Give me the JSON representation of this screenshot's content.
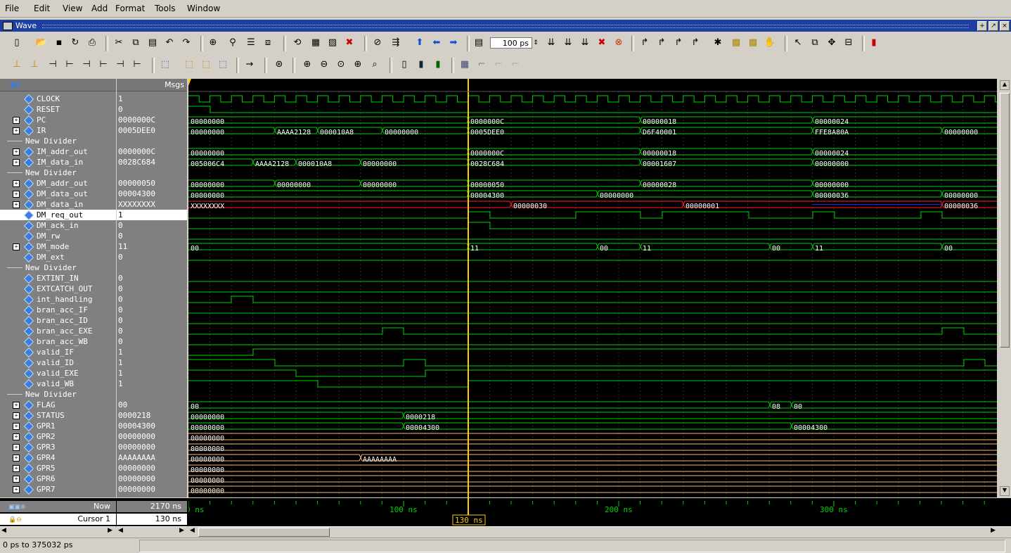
{
  "menu": [
    "File",
    "Edit",
    "View",
    "Add",
    "Format",
    "Tools",
    "Window"
  ],
  "window": {
    "title": "Wave"
  },
  "toolbar": {
    "zoom_value": "100 ps"
  },
  "headers": {
    "msgs": "Msgs"
  },
  "rows": [
    {
      "name": "CLOCK",
      "value": "1",
      "kind": "sig"
    },
    {
      "name": "RESET",
      "value": "0",
      "kind": "sig"
    },
    {
      "name": "PC",
      "value": "0000000C",
      "kind": "bus"
    },
    {
      "name": "IR",
      "value": "0005DEE0",
      "kind": "bus"
    },
    {
      "name": "New Divider",
      "value": "",
      "kind": "div"
    },
    {
      "name": "IM_addr_out",
      "value": "0000000C",
      "kind": "bus"
    },
    {
      "name": "IM_data_in",
      "value": "0028C684",
      "kind": "bus"
    },
    {
      "name": "New Divider",
      "value": "",
      "kind": "div"
    },
    {
      "name": "DM_addr_out",
      "value": "00000050",
      "kind": "bus"
    },
    {
      "name": "DM_data_out",
      "value": "00004300",
      "kind": "bus"
    },
    {
      "name": "DM_data_in",
      "value": "XXXXXXXX",
      "kind": "bus"
    },
    {
      "name": "DM_req_out",
      "value": "1",
      "kind": "sig",
      "selected": true
    },
    {
      "name": "DM_ack_in",
      "value": "0",
      "kind": "sig"
    },
    {
      "name": "DM_rw",
      "value": "0",
      "kind": "sig"
    },
    {
      "name": "DM_mode",
      "value": "11",
      "kind": "bus"
    },
    {
      "name": "DM_ext",
      "value": "0",
      "kind": "sig"
    },
    {
      "name": "New Divider",
      "value": "",
      "kind": "div"
    },
    {
      "name": "EXTINT_IN",
      "value": "0",
      "kind": "sig"
    },
    {
      "name": "EXTCATCH_OUT",
      "value": "0",
      "kind": "sig"
    },
    {
      "name": "int_handling",
      "value": "0",
      "kind": "sig"
    },
    {
      "name": "bran_acc_IF",
      "value": "0",
      "kind": "sig"
    },
    {
      "name": "bran_acc_ID",
      "value": "0",
      "kind": "sig"
    },
    {
      "name": "bran_acc_EXE",
      "value": "0",
      "kind": "sig"
    },
    {
      "name": "bran_acc_WB",
      "value": "0",
      "kind": "sig"
    },
    {
      "name": "valid_IF",
      "value": "1",
      "kind": "sig"
    },
    {
      "name": "valid_ID",
      "value": "1",
      "kind": "sig"
    },
    {
      "name": "valid_EXE",
      "value": "1",
      "kind": "sig"
    },
    {
      "name": "valid_WB",
      "value": "1",
      "kind": "sig"
    },
    {
      "name": "New Divider",
      "value": "",
      "kind": "div"
    },
    {
      "name": "FLAG",
      "value": "00",
      "kind": "bus"
    },
    {
      "name": "STATUS",
      "value": "0000218",
      "kind": "bus"
    },
    {
      "name": "GPR1",
      "value": "00004300",
      "kind": "bus"
    },
    {
      "name": "GPR2",
      "value": "00000000",
      "kind": "bus"
    },
    {
      "name": "GPR3",
      "value": "00000000",
      "kind": "bus"
    },
    {
      "name": "GPR4",
      "value": "AAAAAAAA",
      "kind": "bus"
    },
    {
      "name": "GPR5",
      "value": "00000000",
      "kind": "bus"
    },
    {
      "name": "GPR6",
      "value": "00000000",
      "kind": "bus"
    },
    {
      "name": "GPR7",
      "value": "00000000",
      "kind": "bus"
    }
  ],
  "bus_labels": [
    {
      "row": 2,
      "items": [
        [
          0,
          "00000000"
        ],
        [
          398,
          "0000000C"
        ],
        [
          643,
          "00000018"
        ],
        [
          888,
          "00000024"
        ]
      ]
    },
    {
      "row": 3,
      "items": [
        [
          0,
          "00000000"
        ],
        [
          123,
          "AAAA2128"
        ],
        [
          184,
          "000010A8"
        ],
        [
          276,
          "00000000"
        ],
        [
          398,
          "0005DEE0"
        ],
        [
          643,
          "D6F40001"
        ],
        [
          888,
          "FFE8A80A"
        ],
        [
          1072,
          "00000000"
        ]
      ]
    },
    {
      "row": 5,
      "items": [
        [
          0,
          "00000000"
        ],
        [
          398,
          "0000000C"
        ],
        [
          643,
          "00000018"
        ],
        [
          888,
          "00000024"
        ]
      ]
    },
    {
      "row": 6,
      "items": [
        [
          0,
          "005006C4"
        ],
        [
          92,
          "AAAA2128"
        ],
        [
          153,
          "000010A8"
        ],
        [
          245,
          "00000000"
        ],
        [
          398,
          "0028C684"
        ],
        [
          643,
          "00001607"
        ],
        [
          888,
          "00000000"
        ]
      ]
    },
    {
      "row": 8,
      "items": [
        [
          0,
          "00000000"
        ],
        [
          123,
          "00000000"
        ],
        [
          245,
          "00000000"
        ],
        [
          398,
          "00000050"
        ],
        [
          643,
          "00000028"
        ],
        [
          888,
          "00000000"
        ]
      ]
    },
    {
      "row": 9,
      "items": [
        [
          0,
          "00000000"
        ],
        [
          398,
          "00004300"
        ],
        [
          582,
          "00000000"
        ],
        [
          888,
          "00000036"
        ],
        [
          1072,
          "00000000"
        ]
      ]
    },
    {
      "row": 10,
      "items": [
        [
          0,
          "XXXXXXXX"
        ],
        [
          459,
          "00000030"
        ],
        [
          704,
          "00000001"
        ],
        [
          1072,
          "00000036"
        ]
      ]
    },
    {
      "row": 14,
      "items": [
        [
          0,
          "00"
        ],
        [
          398,
          "11"
        ],
        [
          582,
          "00"
        ],
        [
          643,
          "11"
        ],
        [
          827,
          "00"
        ],
        [
          888,
          "11"
        ],
        [
          1072,
          "00"
        ]
      ]
    },
    {
      "row": 29,
      "items": [
        [
          0,
          "00"
        ],
        [
          827,
          "08"
        ],
        [
          858,
          "00"
        ]
      ]
    },
    {
      "row": 30,
      "items": [
        [
          0,
          "00000000"
        ],
        [
          306,
          "0000218"
        ]
      ]
    },
    {
      "row": 31,
      "items": [
        [
          0,
          "00000000"
        ],
        [
          306,
          "00004300"
        ],
        [
          858,
          "00004300"
        ]
      ]
    },
    {
      "row": 32,
      "items": [
        [
          0,
          "00000000"
        ]
      ]
    },
    {
      "row": 33,
      "items": [
        [
          0,
          "00000000"
        ]
      ]
    },
    {
      "row": 34,
      "items": [
        [
          0,
          "00000000"
        ],
        [
          245,
          "AAAAAAAA"
        ]
      ]
    },
    {
      "row": 35,
      "items": [
        [
          0,
          "00000000"
        ]
      ]
    },
    {
      "row": 36,
      "items": [
        [
          0,
          "00000000"
        ]
      ]
    },
    {
      "row": 37,
      "items": [
        [
          0,
          "00000000"
        ]
      ]
    }
  ],
  "footer": {
    "now_label": "Now",
    "now_value": "2170 ns",
    "cursor_label": "Cursor 1",
    "cursor_value": "130 ns",
    "ticks": [
      "0 ns",
      "100 ns",
      "200 ns",
      "300 ns"
    ],
    "cursor_marker": "130 ns"
  },
  "status": {
    "range": "0 ps to 375032 ps"
  },
  "colors": {
    "wave_green": "#00d000",
    "bus_orange": "#ffb46e",
    "cursor": "#ffcc00",
    "x_red": "#ff2020",
    "sel_blue": "#0030ff"
  }
}
